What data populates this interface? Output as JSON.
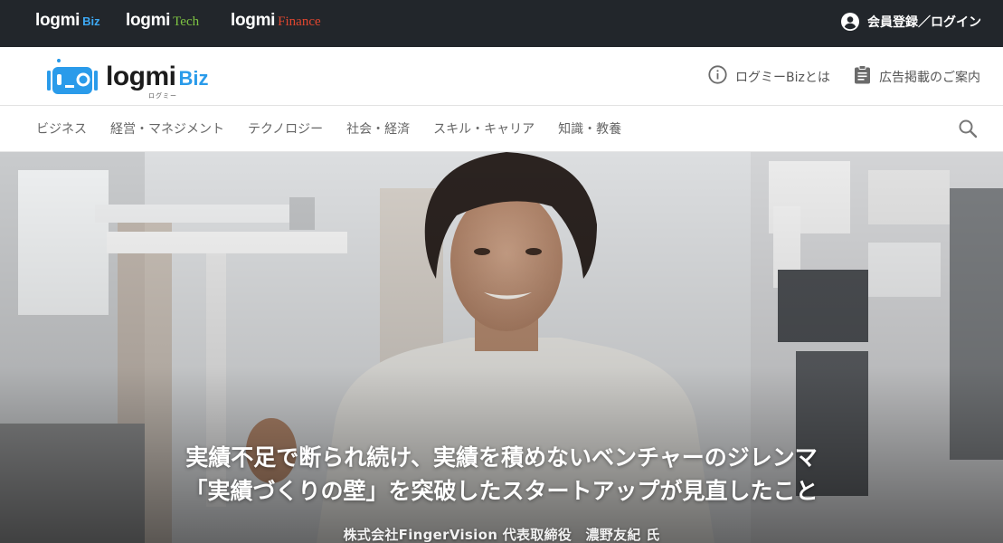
{
  "topbar": {
    "brands": [
      {
        "name": "logmi",
        "suffix": "Biz"
      },
      {
        "name": "logmi",
        "suffix": "Tech"
      },
      {
        "name": "logmi",
        "suffix": "Finance"
      }
    ],
    "login_label": "会員登録／ログイン"
  },
  "header": {
    "logo": {
      "word": "logmi",
      "suffix": "Biz",
      "kana": "ログミー"
    },
    "about_label": "ログミーBizとは",
    "ads_label": "広告掲載のご案内"
  },
  "nav": {
    "items": [
      "ビジネス",
      "経営・マネジメント",
      "テクノロジー",
      "社会・経済",
      "スキル・キャリア",
      "知識・教養"
    ]
  },
  "hero": {
    "title_line1": "実績不足で断られ続け、実績を積めないベンチャーのジレンマ",
    "title_line2": "「実績づくりの壁」を突破したスタートアップが見直したこと",
    "byline": "株式会社FingerVision 代表取締役　濃野友紀 氏"
  },
  "colors": {
    "topbar_bg": "#22262b",
    "biz_blue": "#3da9f5",
    "tech_green": "#7dc242",
    "finance_red": "#e0462f",
    "logo_robot_blue": "#2a9bea"
  },
  "icons": [
    "user-circle-icon",
    "robot-logo-icon",
    "info-circle-icon",
    "clipboard-icon",
    "search-icon"
  ]
}
